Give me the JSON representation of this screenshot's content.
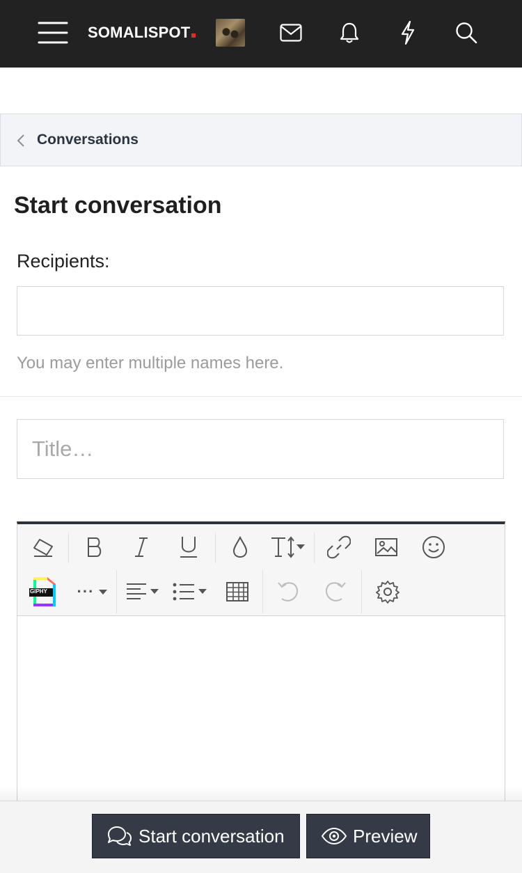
{
  "header": {
    "logo_text": "SOMALISPOT",
    "icons": [
      "menu-icon",
      "mail-icon",
      "bell-icon",
      "lightning-icon",
      "search-icon"
    ]
  },
  "breadcrumb": {
    "label": "Conversations"
  },
  "page": {
    "title": "Start conversation"
  },
  "recipients": {
    "label": "Recipients:",
    "value": "",
    "hint": "You may enter multiple names here."
  },
  "title_field": {
    "placeholder": "Title…",
    "value": ""
  },
  "editor": {
    "toolbar_row1": [
      "eraser-icon",
      "bold-icon",
      "italic-icon",
      "underline-icon",
      "color-drop-icon",
      "text-size-icon",
      "link-icon",
      "image-icon",
      "smiley-icon"
    ],
    "toolbar_row2": [
      "giphy-icon",
      "more-icon",
      "align-icon",
      "list-icon",
      "table-icon",
      "undo-icon",
      "redo-icon",
      "settings-icon"
    ],
    "giphy_label": "GIPHY",
    "more_label": "···",
    "content": ""
  },
  "actions": {
    "start_label": "Start conversation",
    "preview_label": "Preview"
  },
  "colors": {
    "header_bg": "#222222",
    "button_bg": "#343b46",
    "crumb_bg": "#f2f4f8",
    "logo_dot": "#d93025"
  }
}
